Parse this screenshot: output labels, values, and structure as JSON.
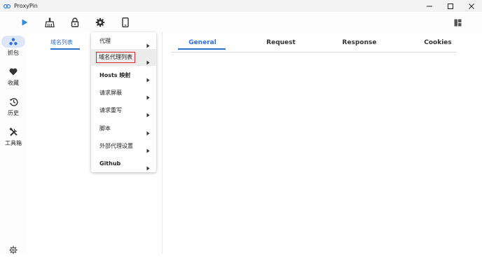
{
  "window": {
    "title": "ProxyPin",
    "controls": [
      "minimize-icon",
      "maximize-icon",
      "close-icon"
    ]
  },
  "toolbar": {
    "buttons": [
      "play-icon",
      "broom-icon",
      "lock-icon",
      "gear-icon",
      "phone-icon"
    ],
    "right_button": "layout-icon",
    "accent": "#2e8be6"
  },
  "sidebar": {
    "items": [
      {
        "label": "抓包",
        "icon": "capture-dots-icon",
        "active": true
      },
      {
        "label": "收藏",
        "icon": "heart-icon"
      },
      {
        "label": "历史",
        "icon": "history-icon"
      },
      {
        "label": "工具箱",
        "icon": "tools-icon"
      }
    ],
    "bottom_icon": "settings-icon"
  },
  "left_panel": {
    "tab_label": "域名列表"
  },
  "menu": {
    "items": [
      {
        "label": "代理",
        "has_submenu": true
      },
      {
        "label": "域名代理列表",
        "has_submenu": true,
        "highlighted": true
      },
      {
        "label": "Hosts 映射",
        "has_submenu": true
      },
      {
        "label": "请求屏蔽",
        "has_submenu": true
      },
      {
        "label": "请求重写",
        "has_submenu": true
      },
      {
        "label": "脚本",
        "has_submenu": true
      },
      {
        "label": "外部代理设置",
        "has_submenu": true
      },
      {
        "label": "Github",
        "has_submenu": true
      }
    ]
  },
  "detail": {
    "tabs": [
      "General",
      "Request",
      "Response",
      "Cookies"
    ],
    "active_tab": "General"
  },
  "colors": {
    "accent": "#2e6fd8",
    "active_pill": "#dde6f7",
    "highlight_border": "#e0252f"
  }
}
